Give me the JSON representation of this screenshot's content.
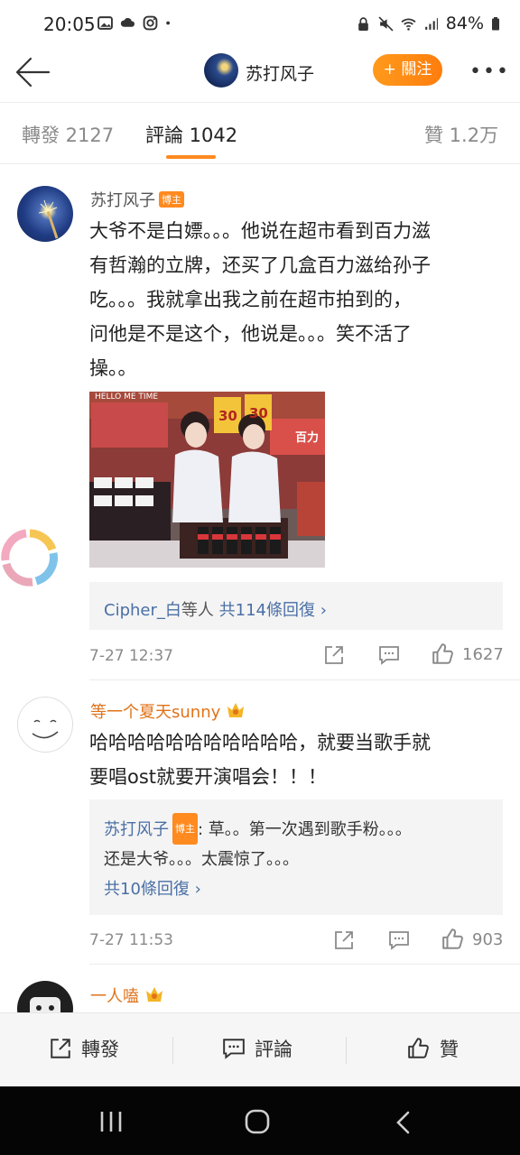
{
  "status_bar": {
    "time": "20:05",
    "battery": "84%"
  },
  "header": {
    "title": "苏打风子",
    "follow_label": "+ 關注",
    "more_label": "•••"
  },
  "tabs": [
    {
      "label": "轉發 2127"
    },
    {
      "label": "評論 1042"
    },
    {
      "label": "贊 1.2万"
    }
  ],
  "comments": [
    {
      "user": "苏打风子",
      "badge": "博主",
      "lines": [
        "大爷不是白嫖。。。他说在超市看到百力滋",
        "有哲瀚的立牌，还买了几盒百力滋给孙子",
        "吃。。。我就拿出我之前在超市拍到的，",
        "问他是不是这个，他说是。。。笑不活了",
        "操。。"
      ],
      "reply_summary_user": "Cipher_白",
      "reply_summary_rest": "等人",
      "reply_summary_count": "共114條回復",
      "time": "7-27 12:37",
      "likes": "1627"
    },
    {
      "user": "等一个夏天sunny",
      "lines": [
        "哈哈哈哈哈哈哈哈哈哈哈，就要当歌手就",
        "要唱ost就要开演唱会！！！"
      ],
      "reply_user": "苏打风子",
      "reply_badge": "博主",
      "reply_lines": [
        ": 草。。第一次遇到歌手粉。。。",
        "还是大爷。。。太震惊了。。。"
      ],
      "reply_count": "共10條回復",
      "time": "7-27 11:53",
      "likes": "903"
    },
    {
      "user": "一人嗑"
    }
  ],
  "photo": {
    "sign_top": "HELLO ME TIME",
    "sign_price": "30",
    "sign_brand": "百力"
  },
  "bottom_bar": {
    "repost": "轉發",
    "comment": "評論",
    "like": "贊"
  },
  "colors": {
    "accent": "#ff8a1f",
    "link": "#4a6fa5",
    "vip_name": "#e0731a"
  }
}
